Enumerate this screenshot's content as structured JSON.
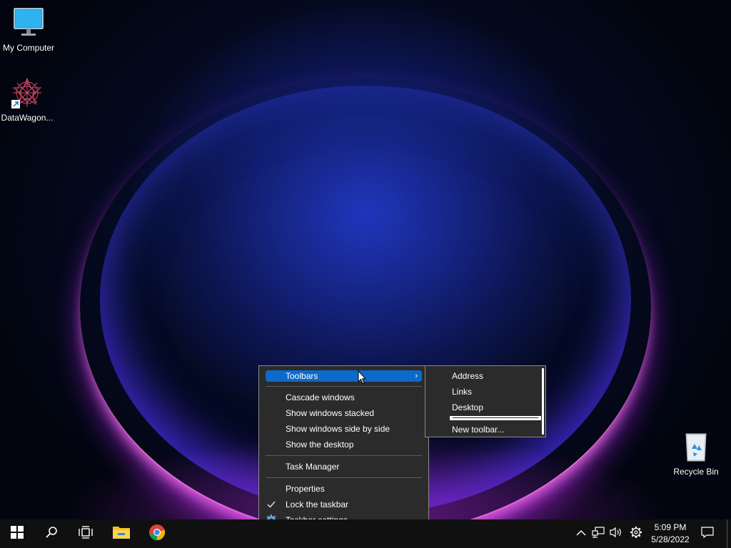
{
  "desktop": {
    "icons": [
      {
        "label": "My Computer"
      },
      {
        "label": "DataWagon..."
      },
      {
        "label": "Recycle Bin"
      }
    ]
  },
  "context_menu": {
    "items": [
      {
        "label": "Toolbars",
        "highlighted": true,
        "has_submenu": true
      },
      {
        "label": "Cascade windows"
      },
      {
        "label": "Show windows stacked"
      },
      {
        "label": "Show windows side by side"
      },
      {
        "label": "Show the desktop"
      },
      {
        "label": "Task Manager"
      },
      {
        "label": "Properties"
      },
      {
        "label": "Lock the taskbar",
        "checked": true
      },
      {
        "label": "Taskbar settings",
        "icon": "gear-icon"
      }
    ]
  },
  "toolbars_submenu": {
    "items": [
      {
        "label": "Address"
      },
      {
        "label": "Links"
      },
      {
        "label": "Desktop"
      },
      {
        "label": "New toolbar..."
      }
    ]
  },
  "taskbar": {
    "buttons": [
      {
        "icon": "windows-start-icon"
      },
      {
        "icon": "search-icon"
      },
      {
        "icon": "task-view-icon"
      },
      {
        "icon": "file-explorer-icon"
      },
      {
        "icon": "chrome-icon"
      }
    ],
    "tray": {
      "icons": [
        "chevron-up-icon",
        "network-icon",
        "volume-icon",
        "settings-gear-icon",
        "notification-icon"
      ],
      "time": "5:09 PM",
      "date": "5/28/2022"
    }
  },
  "colors": {
    "menu_bg": "#2b2b2b",
    "highlight": "#0d6ac9",
    "taskbar_bg": "#101010"
  }
}
